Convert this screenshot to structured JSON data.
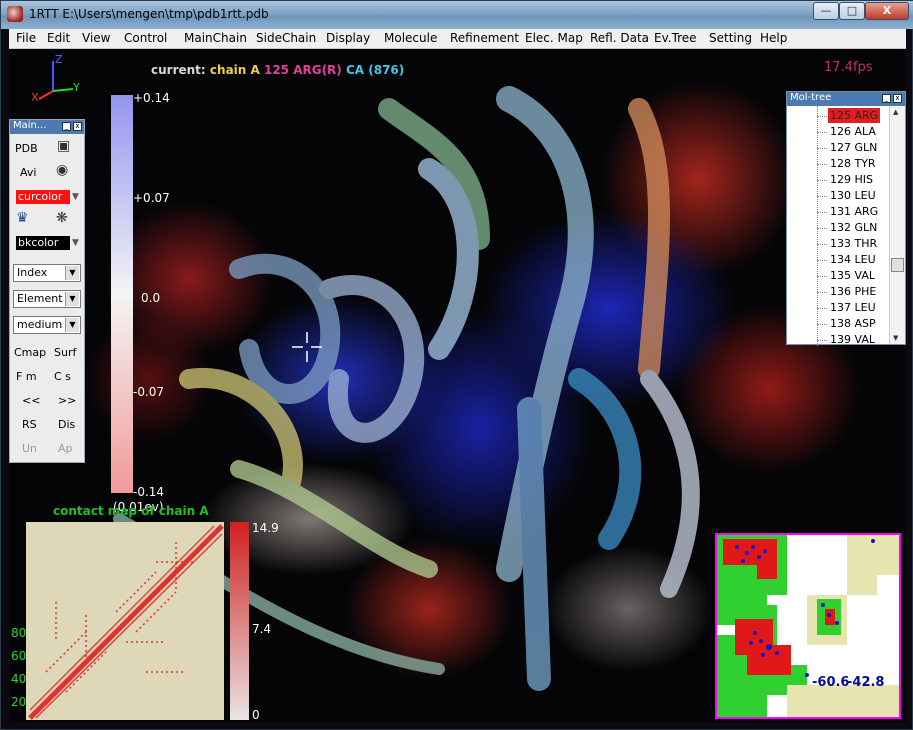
{
  "window": {
    "title": "1RTT  E:\\Users\\mengen\\tmp\\pdb1rtt.pdb",
    "controls": {
      "minimize": "—",
      "maximize": "□",
      "close": "X"
    }
  },
  "menu": [
    "File",
    "Edit",
    "View",
    "Control",
    "MainChain",
    "SideChain",
    "Display",
    "Molecule",
    "Refinement",
    "Elec. Map",
    "Refl. Data",
    "Ev.Tree",
    "Setting",
    "Help"
  ],
  "viewport": {
    "current_label": "current:",
    "current_chain": "chain A",
    "current_residue": "125 ARG(R)",
    "current_atom": "CA (876)",
    "fps": "17.4fps",
    "axes": {
      "x": "X",
      "y": "Y",
      "z": "Z"
    },
    "colors": {
      "chain": "#e6d24a",
      "residue": "#e0409a",
      "atom": "#40c8e8",
      "label": "#d8d8d8"
    }
  },
  "scale_bar": {
    "ticks": [
      "+0.14",
      "+0.07",
      "0.0",
      "-0.07",
      "-0.14"
    ],
    "unit": "(0.01ev)"
  },
  "main_panel": {
    "title": "Main...",
    "pdb_label": "PDB",
    "avi_label": "Avi",
    "curcolor_label": "curcolor",
    "bkcolor_label": "bkcolor",
    "index_select": "Index",
    "element_select": "Element t",
    "size_select": "medium",
    "cmap_label": "Cmap",
    "surf_label": "Surf",
    "fm_label": "F m",
    "cs_label": "C s",
    "prev_label": "<<",
    "next_label": ">>",
    "rs_label": "RS",
    "dis_label": "Dis",
    "un_label": "Un",
    "ap_label": "Ap"
  },
  "moltree": {
    "title": "Mol-tree",
    "items": [
      "125 ARG",
      "126 ALA",
      "127 GLN",
      "128 TYR",
      "129 HIS",
      "130 LEU",
      "131 ARG",
      "132 GLN",
      "133 THR",
      "134 LEU",
      "135 VAL",
      "136 PHE",
      "137 LEU",
      "138 ASP",
      "139 VAL"
    ],
    "selected_index": 0
  },
  "contact_map": {
    "title": "contact map of chain A",
    "y_ticks": [
      "80",
      "60",
      "40",
      "20"
    ],
    "scale_ticks": [
      "14.9",
      "7.4",
      "0"
    ]
  },
  "ramachandran": {
    "phi": "-60.6",
    "psi": "-42.8"
  }
}
